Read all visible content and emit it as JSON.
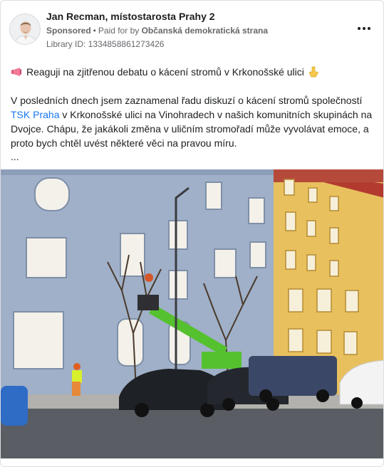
{
  "post": {
    "author": "Jan Recman, místostarosta Prahy 2",
    "sponsored_label": "Sponsored",
    "paid_for_prefix": "Paid for by",
    "paid_for_by": "Občanská demokratická strana",
    "library_id": "Library ID: 1334858861273426",
    "lead_text": "Reaguji na zjitřenou debatu o kácení stromů v Krkonošské ulici",
    "body_before_link": "V posledních dnech jsem zaznamenal řadu diskuzí o kácení stromů společností",
    "link_text": "TSK Praha",
    "body_after_link": "v Krkonošské ulici na Vinohradech v našich komunitních skupinách na Dvojce. Chápu, že jakákoli změna v uličním stromořadí může vyvolávat emoce, a proto bych chtěl uvést některé věci na pravou míru.",
    "ellipsis": "..."
  },
  "icons": {
    "more": "more-options-icon",
    "megaphone": "megaphone-icon",
    "pointing": "pointing-down-icon"
  },
  "colors": {
    "link": "#1877f2",
    "muted": "#65676b",
    "text": "#1c1e21"
  }
}
